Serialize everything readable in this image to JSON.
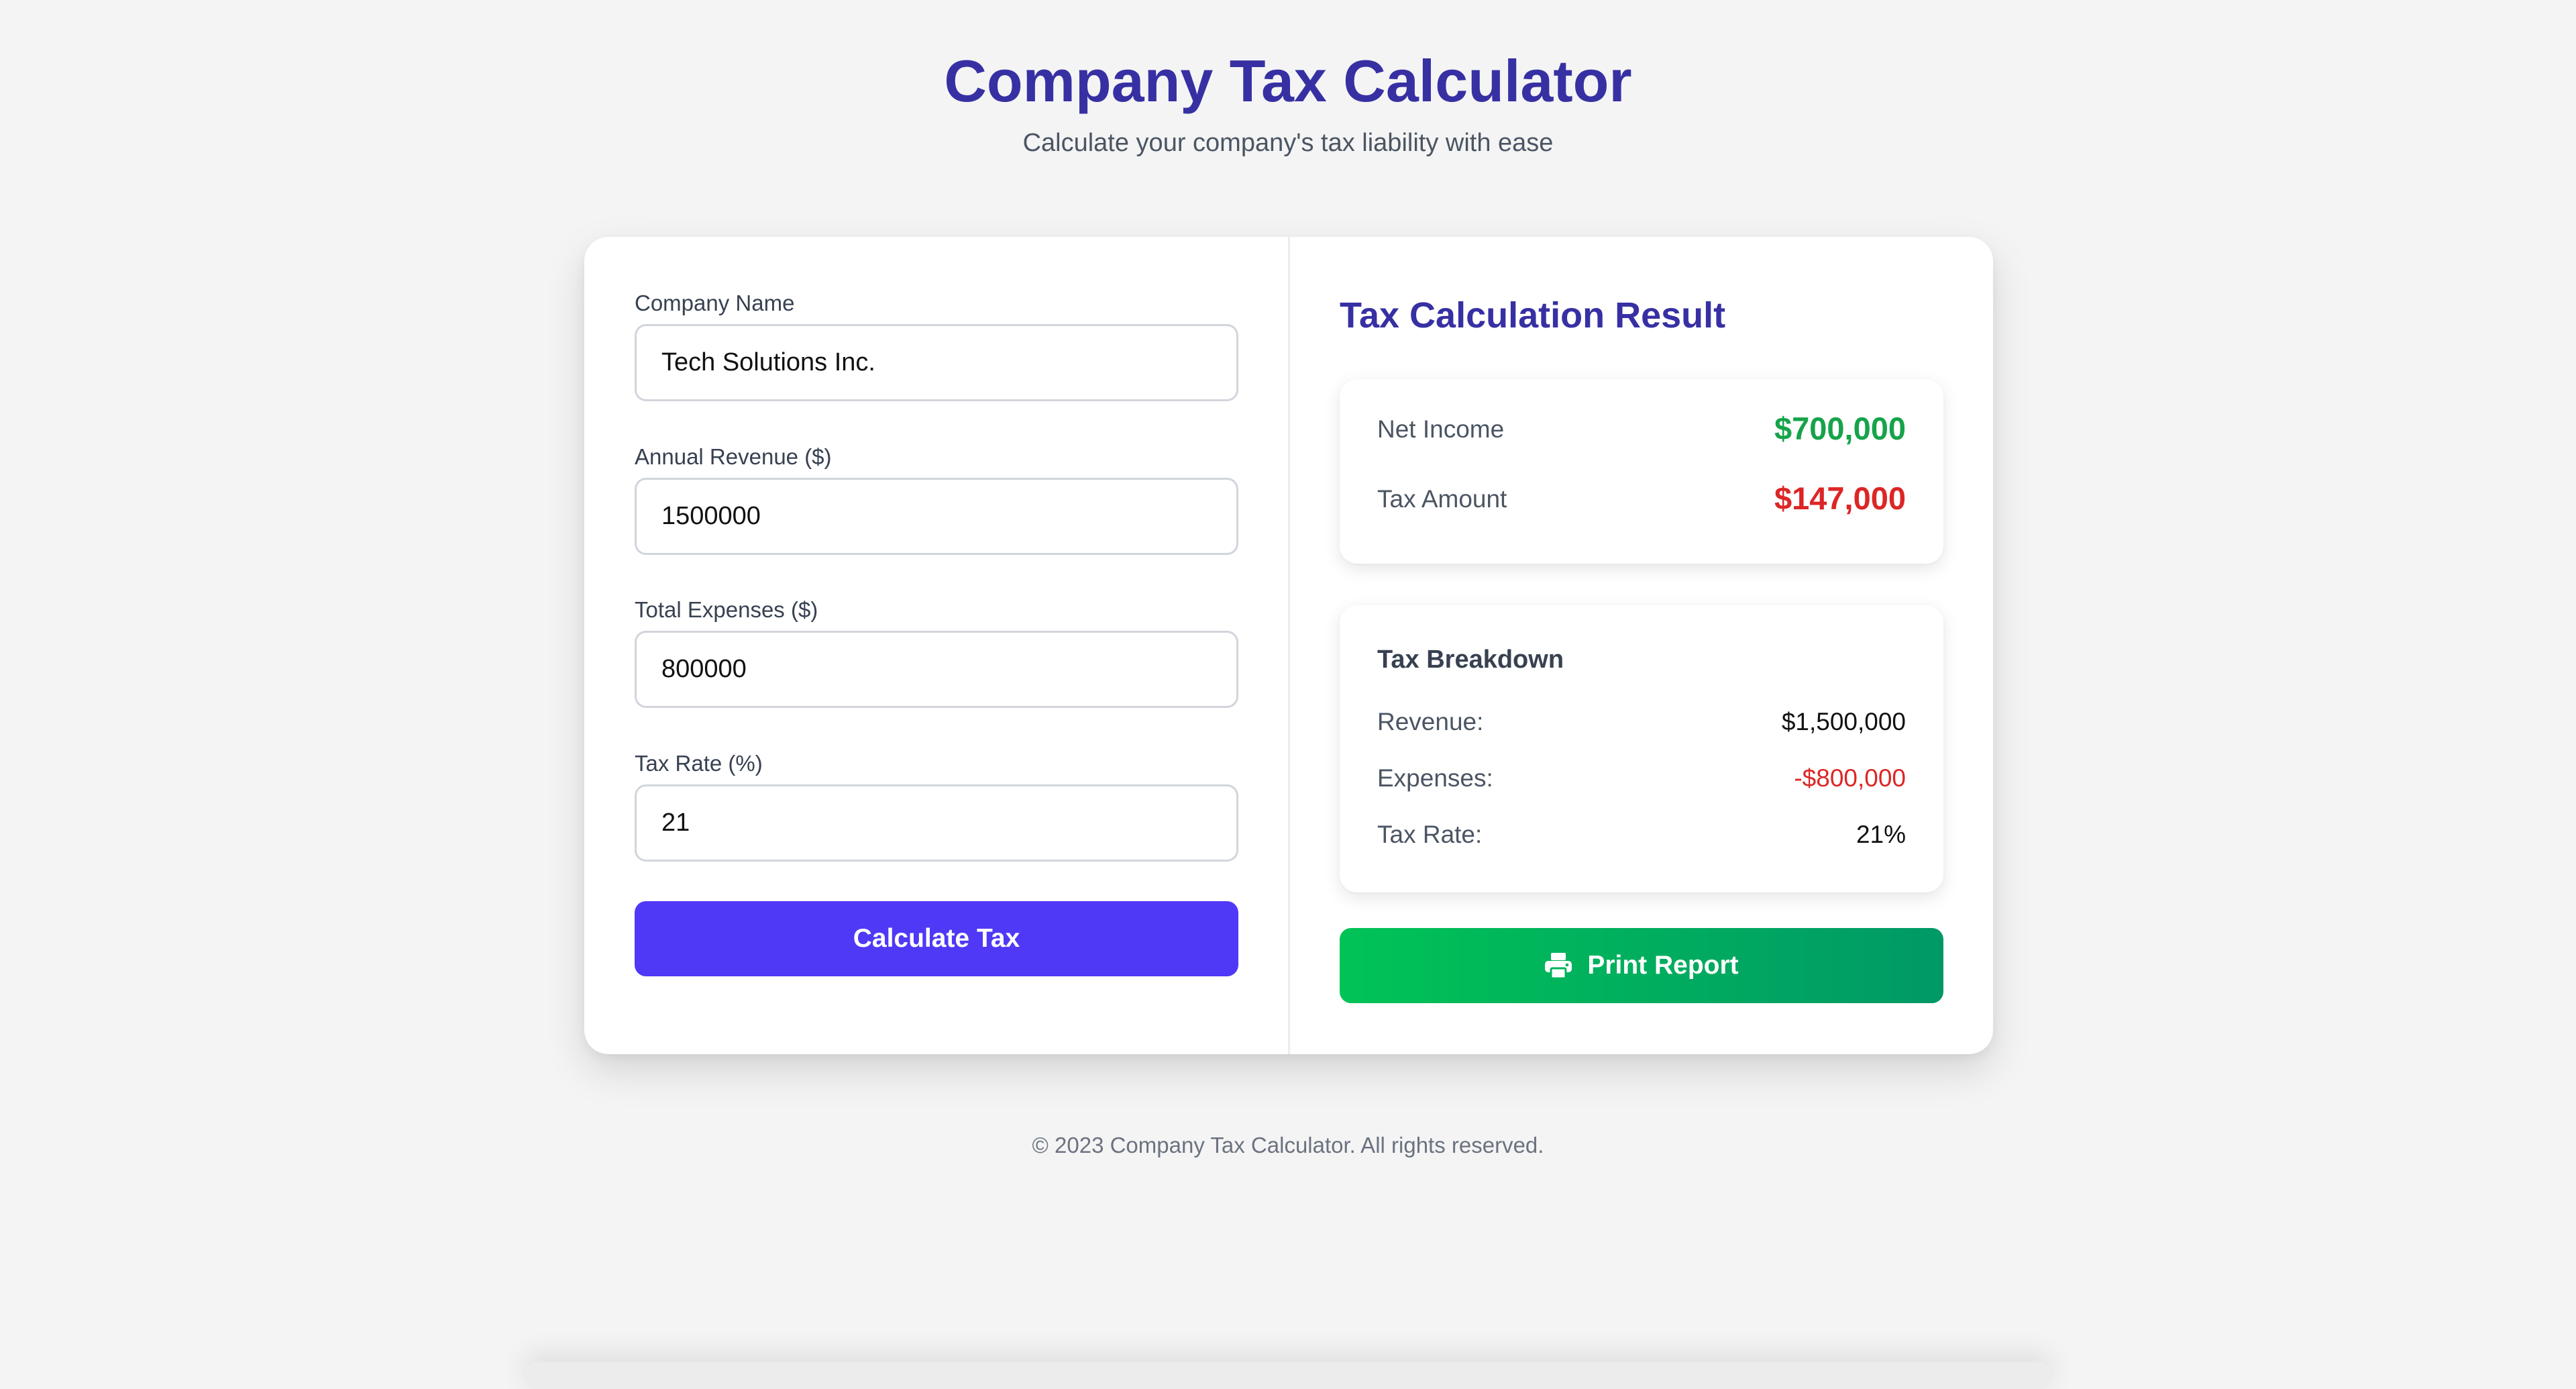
{
  "header": {
    "title": "Company Tax Calculator",
    "subtitle": "Calculate your company's tax liability with ease"
  },
  "form": {
    "company_name": {
      "label": "Company Name",
      "value": "Tech Solutions Inc."
    },
    "annual_revenue": {
      "label": "Annual Revenue ($)",
      "value": "1500000"
    },
    "total_expenses": {
      "label": "Total Expenses ($)",
      "value": "800000"
    },
    "tax_rate": {
      "label": "Tax Rate (%)",
      "value": "21"
    },
    "calculate_label": "Calculate Tax",
    "accent_color": "#4f39f6"
  },
  "result": {
    "title": "Tax Calculation Result",
    "summary": {
      "net_income_label": "Net Income",
      "net_income_value": "$700,000",
      "net_income_color": "#16a34a",
      "tax_amount_label": "Tax Amount",
      "tax_amount_value": "$147,000",
      "tax_amount_color": "#dc2626"
    },
    "breakdown": {
      "title": "Tax Breakdown",
      "revenue_label": "Revenue:",
      "revenue_value": "$1,500,000",
      "expenses_label": "Expenses:",
      "expenses_value": "-$800,000",
      "tax_rate_label": "Tax Rate:",
      "tax_rate_value": "21%"
    },
    "print_label": "Print Report",
    "print_icon": "printer-icon"
  },
  "footer": {
    "text": "© 2023 Company Tax Calculator. All rights reserved."
  }
}
